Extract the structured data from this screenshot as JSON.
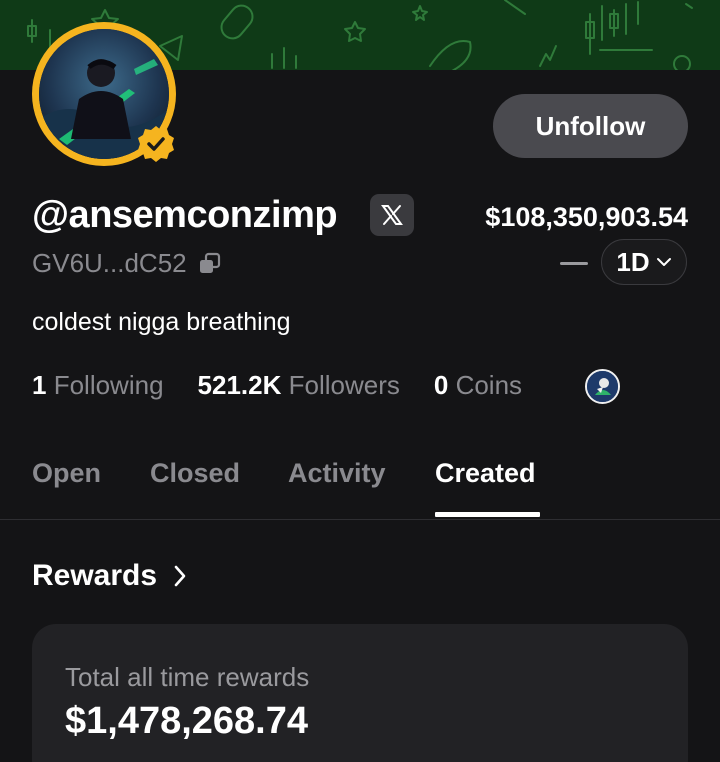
{
  "profile": {
    "username": "@ansemconzimp",
    "wallet_short": "GV6U...dC52",
    "bio": "coldest nigga breathing",
    "balance": "$108,350,903.54",
    "period": "1D",
    "unfollow_label": "Unfollow"
  },
  "stats": {
    "following_count": "1",
    "following_label": "Following",
    "followers_count": "521.2K",
    "followers_label": "Followers",
    "coins_count": "0",
    "coins_label": "Coins"
  },
  "tabs": [
    {
      "label": "Open"
    },
    {
      "label": "Closed"
    },
    {
      "label": "Activity"
    },
    {
      "label": "Created",
      "active": true
    }
  ],
  "rewards": {
    "title": "Rewards",
    "total_label": "Total all time rewards",
    "total_value": "$1,478,268.74"
  },
  "colors": {
    "background": "#141416",
    "banner": "#0f3a17",
    "avatar_ring": "#f5b41f",
    "button_bg": "#4a4a4f",
    "muted_text": "#8a8a8f",
    "card_bg": "#222225"
  },
  "icons": [
    "verified-check-icon",
    "x-logo-icon",
    "copy-icon",
    "chevron-down-icon",
    "chevron-right-icon",
    "coin-avatar-icon"
  ]
}
